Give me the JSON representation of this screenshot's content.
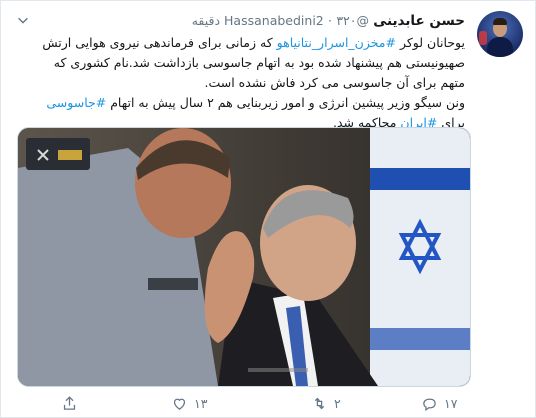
{
  "tweet": {
    "author_name": "حسن عابدینی",
    "author_handle": "@Hassanabedini2",
    "dot": "·",
    "time": "۳۲۰ دقیقه",
    "text_lines": {
      "l1_a": "یوحانان لوکر ",
      "l1_hash": "#مخزن_اسرار_نتانیاهو",
      "l1_b": " که زمانی برای فرماندهی نیروی هوایی ارتش",
      "l2": "صهیونیستی هم پیشنهاد شده بود به اتهام جاسوسی بازداشت شد.نام کشوری که",
      "l3": "متهم برای آن جاسوسی می کرد فاش نشده است.",
      "l4_a": "ونن سیگو وزیر پیشین انرژی و امور زیربنایی هم ۲ سال پیش به اتهام ",
      "l4_hash": "#جاسوسی",
      "l5_a": "برای ",
      "l5_hash": "#ایران",
      "l5_b": " محاکمه شد."
    }
  },
  "actions": {
    "reply_count": "۱۷",
    "retweet_count": "۲",
    "like_count": "۱۳"
  },
  "icons": [
    "chevron-down-icon",
    "reply-icon",
    "retweet-icon",
    "like-icon",
    "share-icon"
  ],
  "colors": {
    "link": "#1b95e0",
    "muted": "#657786"
  }
}
